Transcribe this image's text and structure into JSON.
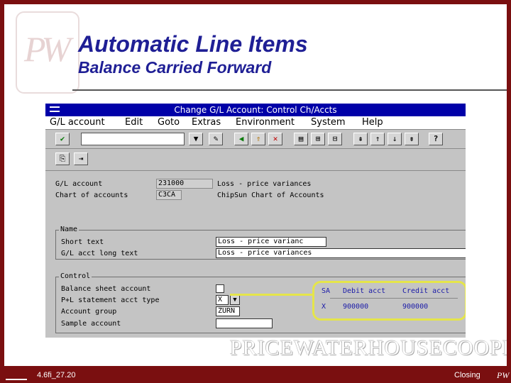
{
  "slide": {
    "title": "Automatic Line Items",
    "subtitle": "Balance Carried Forward",
    "logo_text": "PW",
    "watermark": "PRICEWATERHOUSECOOPERS",
    "footer_code": "4.6fi_27.20",
    "footer_section": "Closing"
  },
  "window": {
    "title": "Change G/L Account: Control Ch/Accts",
    "menu": [
      "G/L account",
      "Edit",
      "Goto",
      "Extras",
      "Environment",
      "System",
      "Help"
    ]
  },
  "form": {
    "gl_account_label": "G/L account",
    "gl_account_value": "231000",
    "gl_account_desc": "Loss - price variances",
    "chart_label": "Chart of accounts",
    "chart_value": "C3CA",
    "chart_desc": "ChipSun Chart of Accounts",
    "name_group": "Name",
    "short_text_label": "Short text",
    "short_text_value": "Loss - price varianc",
    "long_text_label": "G/L acct long text",
    "long_text_value": "Loss - price variances",
    "control_group": "Control",
    "balance_sheet_label": "Balance sheet account",
    "pl_type_label": "P+L statement acct type",
    "pl_type_value": "X",
    "account_group_label": "Account group",
    "account_group_value": "ZURN",
    "sample_account_label": "Sample account",
    "sample_account_value": ""
  },
  "popup": {
    "headers": [
      "SA",
      "Debit acct",
      "Credit acct"
    ],
    "row": [
      "X",
      "900000",
      "900000"
    ]
  },
  "colors": {
    "frame": "#7a0f10",
    "title": "#1f1f95",
    "sap_titlebar": "#0000a8",
    "highlight": "#e5e54a"
  }
}
